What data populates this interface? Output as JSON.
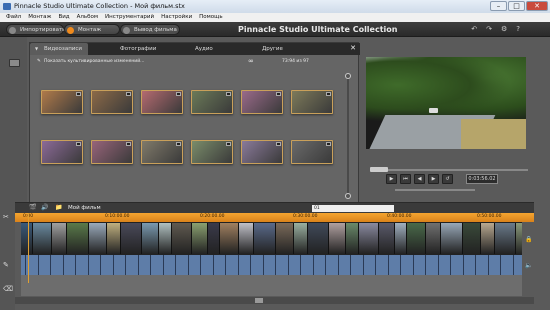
{
  "window": {
    "title": "Pinnacle Studio Ultimate Collection - Мой фильм.stx"
  },
  "menu": [
    "Файл",
    "Монтаж",
    "Вид",
    "Альбом",
    "Инструментарий",
    "Настройки",
    "Помощь"
  ],
  "modes": [
    {
      "label": "Импортировать"
    },
    {
      "label": "Монтаж"
    },
    {
      "label": "Вывод фильма"
    }
  ],
  "app_title": "Pinnacle Studio Ultimate Collection",
  "library": {
    "tabs": [
      "Видеозаписи",
      "Фотографии",
      "Аудио",
      "Другие"
    ],
    "scene_text": "Показать культивированные изменений...",
    "count": "73:94 из 97",
    "thumb_colors": [
      "#b07a4a",
      "#8c6a48",
      "#b56a70",
      "#6b7a58",
      "#9a6a8a",
      "#7d7a5a",
      "#8c6a98",
      "#98647a",
      "#807a6a",
      "#7a8c6a",
      "#8a7a9a",
      "#6a6a6a"
    ]
  },
  "player": {
    "timecode": "0:03:56.02"
  },
  "timeline": {
    "movie_label": "Мой фильм",
    "search_value": "01",
    "ruler": [
      "0:00",
      "0:10:00.00",
      "0:20:00.00",
      "0:30:00.00",
      "0:40:00.00",
      "0:50:00.00"
    ],
    "clip_colors": [
      "#3a5a7a",
      "#6a8aa0",
      "#a0a0a0",
      "#5a7a4a",
      "#9aaabb",
      "#c0b080",
      "#4a4a5a",
      "#7a9ab0",
      "#b0c0c0",
      "#605a50",
      "#8aa070",
      "#3a3a4a",
      "#a08060",
      "#c0c0c8",
      "#5a6a8a",
      "#7a6a5a",
      "#9ab0a0",
      "#404a5a",
      "#b0a0a0",
      "#6a8a6a",
      "#8a8aa0",
      "#5a5a6a",
      "#a0b0c0",
      "#4a6a4a",
      "#707070",
      "#98a8b8",
      "#3a4a3a",
      "#b8a890",
      "#6a7a8a",
      "#8a9a7a",
      "#505a60",
      "#a0a0b0"
    ]
  }
}
